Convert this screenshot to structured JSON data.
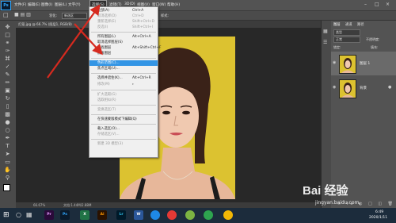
{
  "app": {
    "logo": "Ps"
  },
  "menubar": {
    "items": [
      "文件(F)",
      "编辑(E)",
      "图像(I)",
      "图层(L)",
      "文字(Y)",
      "选择(S)",
      "滤镜(T)",
      "3D(D)",
      "视图(V)",
      "窗口(W)",
      "帮助(H)"
    ]
  },
  "optbar": {
    "mode_value": "新选区",
    "feather_label": "羽化:",
    "style_label": "样式:",
    "style_value": "正常"
  },
  "document": {
    "tab_title": "灯笼.jpg @ 66.7% (图层1, RGB/8)"
  },
  "status": {
    "zoom": "66.67%",
    "doc_info": "文档:1.44M/2.88M"
  },
  "select_menu": {
    "items": [
      {
        "label": "全部(A)",
        "shortcut": "Ctrl+A",
        "enabled": true
      },
      {
        "label": "取消选择(D)",
        "shortcut": "Ctrl+D",
        "enabled": false
      },
      {
        "label": "重新选择(E)",
        "shortcut": "Shift+Ctrl+D",
        "enabled": false
      },
      {
        "label": "反选(I)",
        "shortcut": "Shift+Ctrl+I",
        "enabled": false
      },
      {
        "label": "所有图层(L)",
        "shortcut": "Alt+Ctrl+A",
        "enabled": true
      },
      {
        "label": "取消选择图层(S)",
        "shortcut": "",
        "enabled": true
      },
      {
        "label": "查找图层",
        "shortcut": "Alt+Shift+Ctrl+F",
        "enabled": true
      },
      {
        "label": "隔离图层",
        "shortcut": "",
        "enabled": true
      },
      {
        "label": "色彩范围(C)...",
        "shortcut": "",
        "enabled": true,
        "highlighted": true
      },
      {
        "label": "焦点区域(U)...",
        "shortcut": "",
        "enabled": true
      },
      {
        "label": "选择并遮住(K)...",
        "shortcut": "Alt+Ctrl+R",
        "enabled": true
      },
      {
        "label": "修改(M)",
        "shortcut": "",
        "enabled": false
      },
      {
        "label": "扩大选取(G)",
        "shortcut": "",
        "enabled": false
      },
      {
        "label": "选取相似(R)",
        "shortcut": "",
        "enabled": false
      },
      {
        "label": "变换选区(T)",
        "shortcut": "",
        "enabled": false
      },
      {
        "label": "在快速蒙版模式下编辑(Q)",
        "shortcut": "",
        "enabled": true
      },
      {
        "label": "载入选区(O)...",
        "shortcut": "",
        "enabled": true
      },
      {
        "label": "存储选区(V)...",
        "shortcut": "",
        "enabled": false
      },
      {
        "label": "新建 3D 模型(3)",
        "shortcut": "",
        "enabled": false
      }
    ]
  },
  "layers_panel": {
    "tabs": [
      "图层",
      "通道",
      "路径"
    ],
    "kind_label": "类型",
    "blend_mode": "正常",
    "opacity_label": "不透明度:",
    "lock_label": "锁定:",
    "fill_label": "填充:",
    "layers": [
      {
        "name": "图层 1"
      },
      {
        "name": "背景"
      }
    ]
  },
  "taskbar": {
    "apps": [
      "Pr",
      "Ps",
      "Ai",
      "Lr",
      "W",
      "X"
    ],
    "time": "6:49",
    "date": "2020/1/11"
  },
  "watermark": {
    "brand": "Bai 经验",
    "url": "jingyan.baidu.com"
  },
  "colors": {
    "accent": "#3395e5",
    "photo_bg": "#dcc230",
    "arrow": "#d62a1f"
  }
}
